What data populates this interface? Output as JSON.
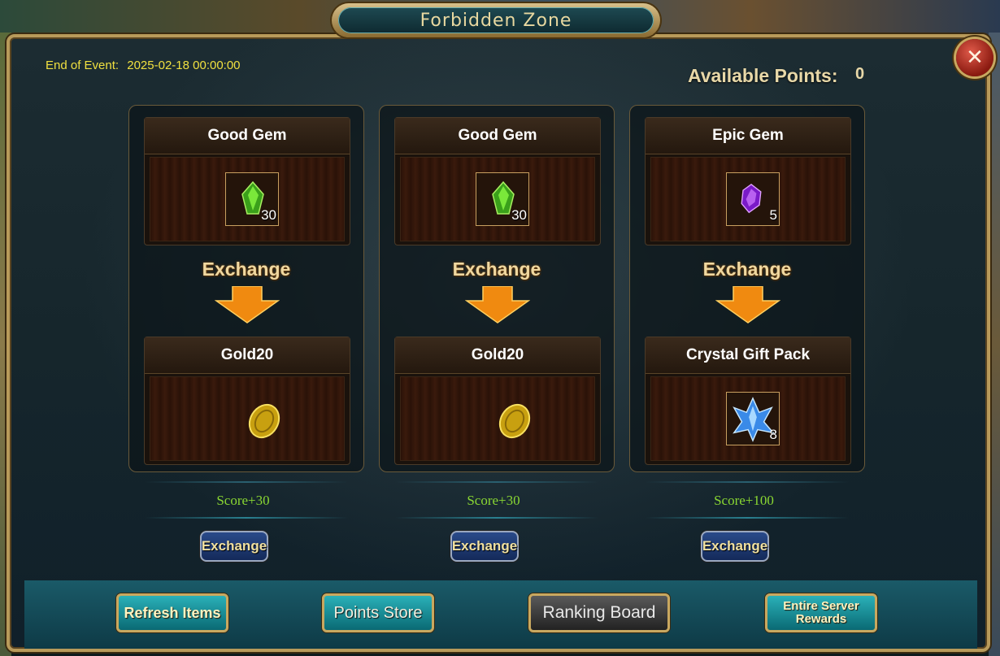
{
  "window": {
    "title": "Forbidden Zone",
    "close_symbol": "✕",
    "event_end_label": "End of Event:",
    "event_end_time": "2025-02-18 00:00:00",
    "available_points_label": "Available Points:",
    "available_points_value": "0"
  },
  "cards": [
    {
      "input_name": "Good Gem",
      "input_icon": "green-gem-icon",
      "input_count": "30",
      "exchange_label": "Exchange",
      "output_name": "Gold20",
      "output_icon": "gold-coin-icon",
      "output_count": "",
      "score": "Score+30",
      "button_label": "Exchange"
    },
    {
      "input_name": "Good Gem",
      "input_icon": "green-gem-icon",
      "input_count": "30",
      "exchange_label": "Exchange",
      "output_name": "Gold20",
      "output_icon": "gold-coin-icon",
      "output_count": "",
      "score": "Score+30",
      "button_label": "Exchange"
    },
    {
      "input_name": "Epic Gem",
      "input_icon": "purple-gem-icon",
      "input_count": "5",
      "exchange_label": "Exchange",
      "output_name": "Crystal Gift Pack",
      "output_icon": "crystal-icon",
      "output_count": "8",
      "score": "Score+100",
      "button_label": "Exchange"
    }
  ],
  "bottom_bar": {
    "refresh_label": "Refresh Items",
    "store_label": "Points Store",
    "ranking_label": "Ranking Board",
    "server_rewards_label_1": "Entire Server",
    "server_rewards_label_2": "Rewards"
  },
  "colors": {
    "score_green": "#8ad832",
    "event_yellow": "#f0e040",
    "gold_border": "#c8a860"
  }
}
